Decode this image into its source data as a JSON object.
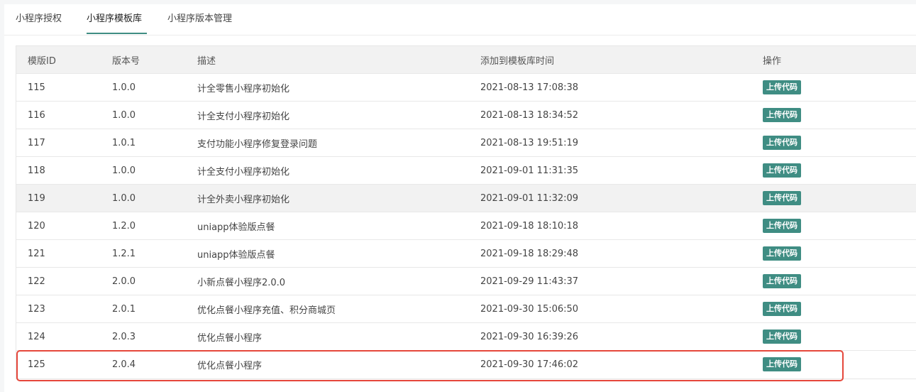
{
  "tabs": [
    {
      "label": "小程序授权",
      "active": false
    },
    {
      "label": "小程序模板库",
      "active": true
    },
    {
      "label": "小程序版本管理",
      "active": false
    }
  ],
  "colors": {
    "accent": "#3f8d83",
    "highlight": "#e5473b"
  },
  "table": {
    "headers": [
      "模版ID",
      "版本号",
      "描述",
      "添加到模板库时间",
      "操作"
    ],
    "rows": [
      {
        "id": "115",
        "version": "1.0.0",
        "desc": "计全零售小程序初始化",
        "time": "2021-08-13 17:08:38",
        "action": "上传代码"
      },
      {
        "id": "116",
        "version": "1.0.0",
        "desc": "计全支付小程序初始化",
        "time": "2021-08-13 18:34:52",
        "action": "上传代码"
      },
      {
        "id": "117",
        "version": "1.0.1",
        "desc": "支付功能小程序修复登录问题",
        "time": "2021-08-13 19:51:19",
        "action": "上传代码"
      },
      {
        "id": "118",
        "version": "1.0.0",
        "desc": "计全支付小程序初始化",
        "time": "2021-09-01 11:31:35",
        "action": "上传代码"
      },
      {
        "id": "119",
        "version": "1.0.0",
        "desc": "计全外卖小程序初始化",
        "time": "2021-09-01 11:32:09",
        "action": "上传代码"
      },
      {
        "id": "120",
        "version": "1.2.0",
        "desc": "uniapp体验版点餐",
        "time": "2021-09-18 18:10:18",
        "action": "上传代码"
      },
      {
        "id": "121",
        "version": "1.2.1",
        "desc": "uniapp体验版点餐",
        "time": "2021-09-18 18:29:48",
        "action": "上传代码"
      },
      {
        "id": "122",
        "version": "2.0.0",
        "desc": "小新点餐小程序2.0.0",
        "time": "2021-09-29 11:43:37",
        "action": "上传代码"
      },
      {
        "id": "123",
        "version": "2.0.1",
        "desc": "优化点餐小程序充值、积分商城页",
        "time": "2021-09-30 15:06:50",
        "action": "上传代码"
      },
      {
        "id": "124",
        "version": "2.0.3",
        "desc": "优化点餐小程序",
        "time": "2021-09-30 16:39:26",
        "action": "上传代码"
      },
      {
        "id": "125",
        "version": "2.0.4",
        "desc": "优化点餐小程序",
        "time": "2021-09-30 17:46:02",
        "action": "上传代码"
      }
    ]
  }
}
